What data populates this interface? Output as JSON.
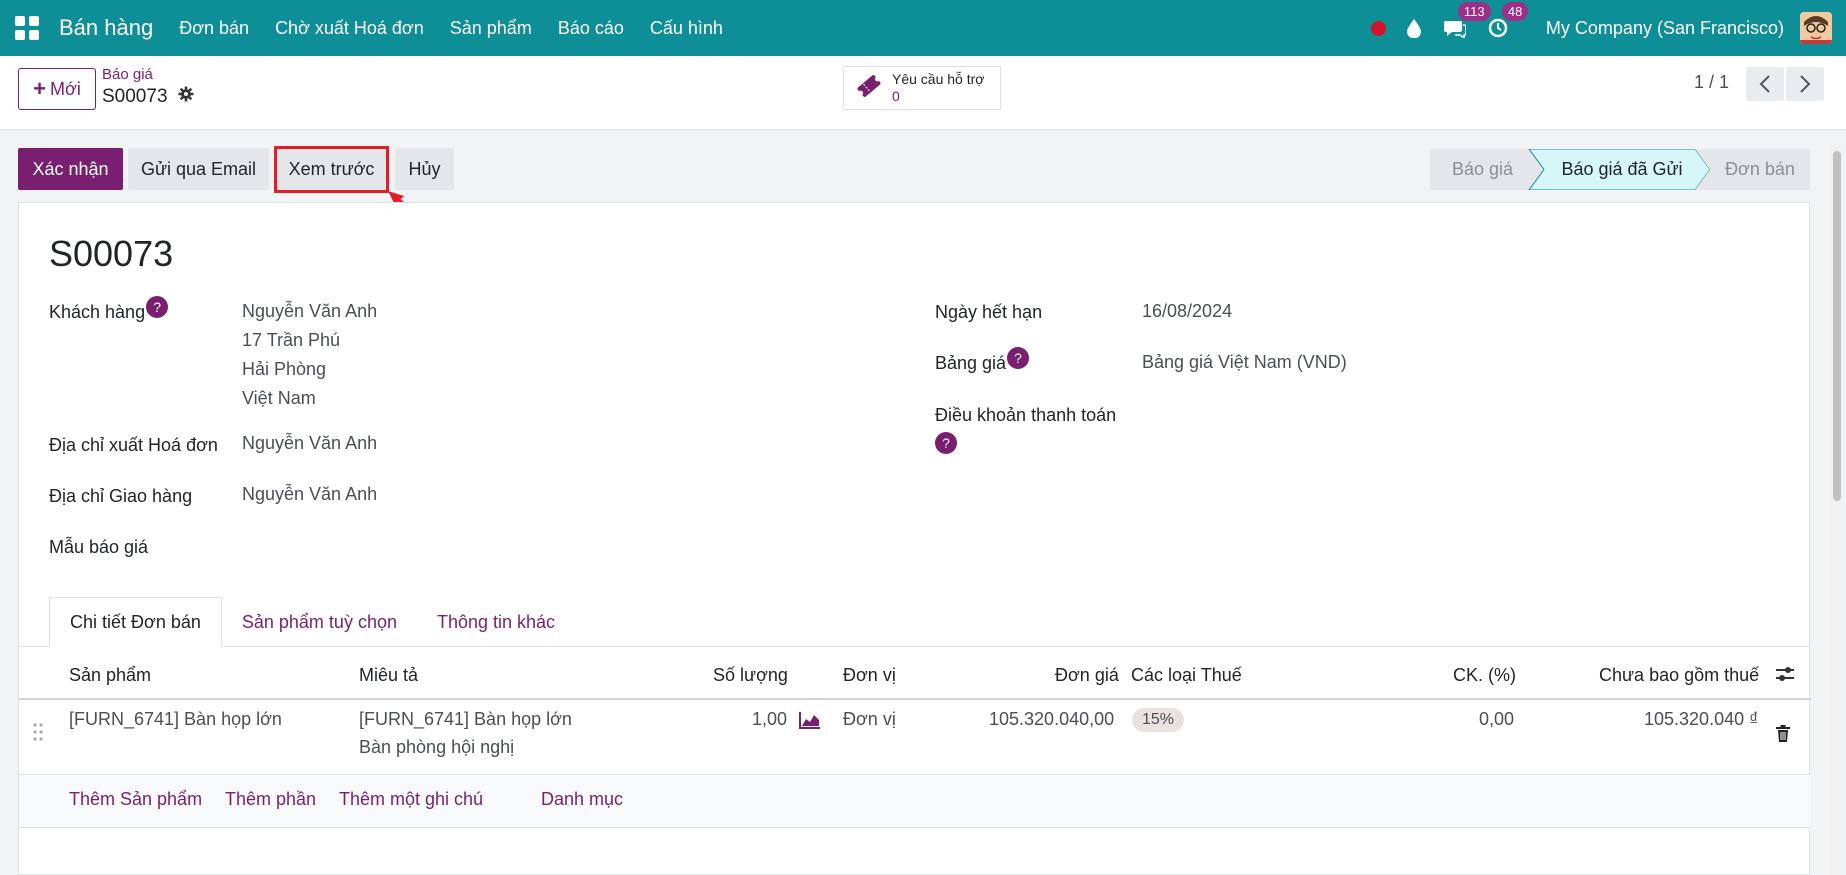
{
  "navbar": {
    "brand": "Bán hàng",
    "menu": [
      "Đơn bán",
      "Chờ xuất Hoá đơn",
      "Sản phẩm",
      "Báo cáo",
      "Cấu hình"
    ],
    "messages_count": "113",
    "activities_count": "48",
    "company": "My Company (San Francisco)"
  },
  "control": {
    "new_label": "Mới",
    "breadcrumb_parent": "Báo giá",
    "breadcrumb_current": "S00073",
    "support_label": "Yêu cầu hỗ trợ",
    "support_count": "0",
    "pager": "1 / 1"
  },
  "actions": {
    "confirm": "Xác nhận",
    "send_email": "Gửi qua Email",
    "preview": "Xem trước",
    "cancel": "Hủy"
  },
  "stages": [
    {
      "label": "Báo giá",
      "state": "done"
    },
    {
      "label": "Báo giá đã Gửi",
      "state": "current"
    },
    {
      "label": "Đơn bán",
      "state": "todo"
    }
  ],
  "form": {
    "title": "S00073",
    "customer_label": "Khách hàng",
    "customer_lines": [
      "Nguyễn Văn Anh",
      "17 Trần Phú",
      "Hải Phòng",
      "Việt Nam"
    ],
    "invoice_address_label": "Địa chỉ xuất Hoá đơn",
    "invoice_address": "Nguyễn Văn Anh",
    "delivery_address_label": "Địa chỉ Giao hàng",
    "delivery_address": "Nguyễn Văn Anh",
    "quote_template_label": "Mẫu báo giá",
    "expiry_label": "Ngày hết hạn",
    "expiry": "16/08/2024",
    "pricelist_label": "Bảng giá",
    "pricelist": "Bảng giá Việt Nam (VND)",
    "payment_terms_label": "Điều khoản thanh toán"
  },
  "tabs": [
    "Chi tiết Đơn bán",
    "Sản phẩm tuỳ chọn",
    "Thông tin khác"
  ],
  "table": {
    "headers": [
      "Sản phẩm",
      "Miêu tả",
      "Số lượng",
      "Đơn vị",
      "Đơn giá",
      "Các loại Thuế",
      "CK. (%)",
      "Chưa bao gồm thuế"
    ],
    "rows": [
      {
        "product": "[FURN_6741] Bàn họp lớn",
        "description_1": "[FURN_6741] Bàn họp lớn",
        "description_2": "Bàn phòng hội nghị",
        "quantity": "1,00",
        "uom": "Đơn vị",
        "unit_price": "105.320.040,00",
        "tax": "15%",
        "discount": "0,00",
        "subtotal": "105.320.040 ₫"
      }
    ],
    "add_product": "Thêm Sản phẩm",
    "add_section": "Thêm phần",
    "add_note": "Thêm một ghi chú",
    "catalog": "Danh mục"
  },
  "colors": {
    "navbar": "#0e8e96",
    "primary": "#7a1f6f",
    "highlight": "#e51e25",
    "stage_current": "#d6f6f8"
  }
}
